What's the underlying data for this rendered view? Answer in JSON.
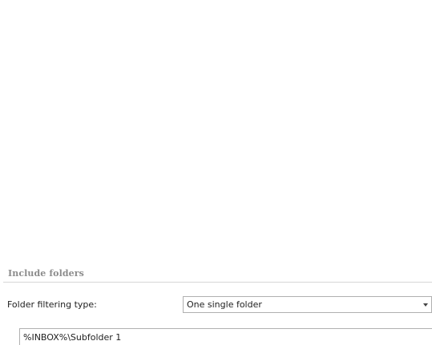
{
  "include_folders": {
    "section_title": "Include folders",
    "filter_type_label": "Folder filtering type:",
    "filter_type_value": "One single folder",
    "folder_path_value": "%INBOX%\\Subfolder 1"
  }
}
